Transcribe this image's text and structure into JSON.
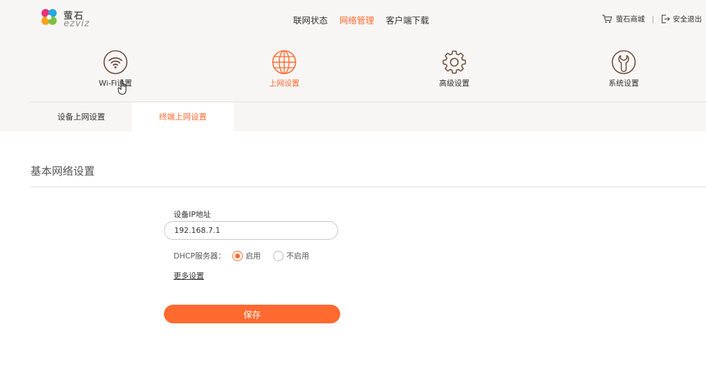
{
  "brand": {
    "name_cn": "萤石",
    "name_en": "ezviz"
  },
  "topnav": [
    {
      "label": "联网状态",
      "active": false
    },
    {
      "label": "网络管理",
      "active": true
    },
    {
      "label": "客户端下载",
      "active": false
    }
  ],
  "header_right": {
    "shop_label": "萤石商城",
    "logout_label": "安全退出",
    "separator": "|"
  },
  "categories": [
    {
      "label": "Wi-Fi设置",
      "icon": "wifi-icon",
      "active": false
    },
    {
      "label": "上网设置",
      "icon": "globe-icon",
      "active": true
    },
    {
      "label": "高级设置",
      "icon": "gear-icon",
      "active": false
    },
    {
      "label": "系统设置",
      "icon": "wrench-icon",
      "active": false
    }
  ],
  "tabs": [
    {
      "label": "设备上网设置",
      "active": false
    },
    {
      "label": "终端上网设置",
      "active": true
    }
  ],
  "section": {
    "title": "基本网络设置"
  },
  "form": {
    "ip_label": "设备IP地址",
    "ip_value": "192.168.7.1",
    "dhcp_label": "DHCP服务器：",
    "dhcp_options": [
      {
        "label": "启用",
        "checked": true
      },
      {
        "label": "不启用",
        "checked": false
      }
    ],
    "more_link": "更多设置",
    "save_label": "保存"
  },
  "colors": {
    "accent": "#ff6a30",
    "band_bg": "#f7f6f4",
    "icon_stroke": "#6b4a3a"
  }
}
